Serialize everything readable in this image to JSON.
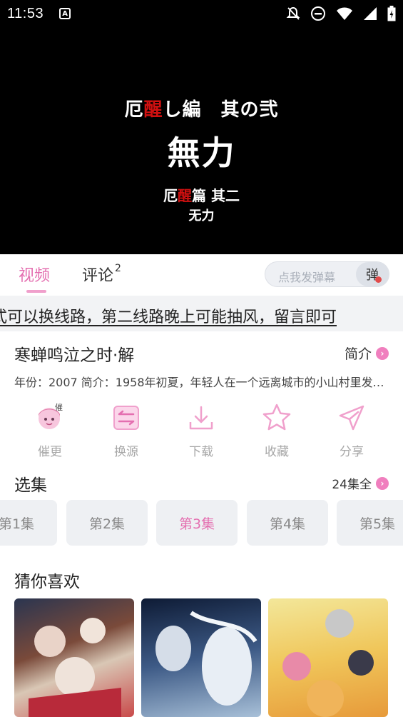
{
  "status_bar": {
    "time": "11:53",
    "app_badge": "A"
  },
  "video": {
    "line1_a": "厄",
    "line1_red": "醒",
    "line1_b": "し編　其の弐",
    "line2": "無力",
    "line3_a": "厄",
    "line3_red": "醒",
    "line3_b": "篇 其二",
    "line4": "无力"
  },
  "tabs": {
    "video": "视频",
    "comment": "评论",
    "comment_count": "2"
  },
  "danmu": {
    "placeholder": "点我发弹幕",
    "button": "弹"
  },
  "notice": "式可以换线路，第二线路晚上可能抽风，留言即可",
  "show": {
    "title": "寒蝉鸣泣之时·解",
    "intro_link": "简介",
    "description": "年份：2007  简介：1958年初夏，年轻人在一个远离城市的小山村里发生的离奇杀人事件……"
  },
  "actions": [
    {
      "label": "催更",
      "icon": "mascot-girl-icon"
    },
    {
      "label": "换源",
      "icon": "swap-source-icon"
    },
    {
      "label": "下载",
      "icon": "download-icon"
    },
    {
      "label": "收藏",
      "icon": "star-icon"
    },
    {
      "label": "分享",
      "icon": "share-icon"
    }
  ],
  "episodes_section": {
    "title": "选集",
    "count": "24集全",
    "items": [
      "第1集",
      "第2集",
      "第3集",
      "第4集",
      "第5集"
    ],
    "selected": "第3集"
  },
  "recommend": {
    "title": "猜你喜欢"
  },
  "colors": {
    "accent": "#e46fb0",
    "icon": "#f0a0cc",
    "black": "#000000"
  }
}
